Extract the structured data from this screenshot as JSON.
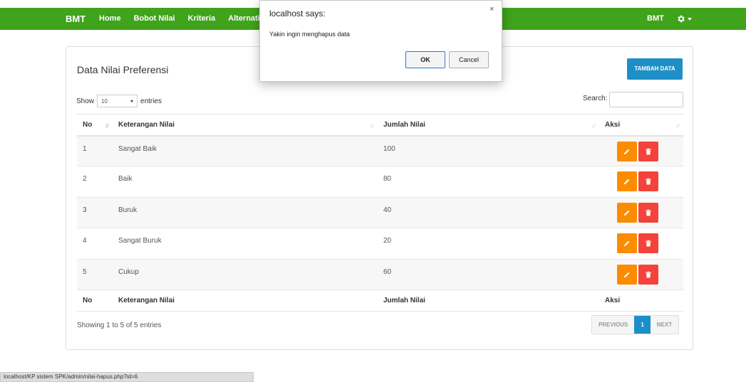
{
  "navbar": {
    "brand": "BMT",
    "items": [
      "Home",
      "Bobot Nilai",
      "Kriteria",
      "Alternati"
    ],
    "user": "BMT",
    "accent": "#3fa31c"
  },
  "panel": {
    "title": "Data Nilai Preferensi",
    "add_button": "TAMBAH DATA",
    "show_label": "Show",
    "entries_value": "10",
    "entries_label": "entries",
    "search_label": "Search:",
    "search_value": ""
  },
  "table": {
    "headers": [
      "No",
      "Keterangan Nilai",
      "Jumlah Nilai",
      "Aksi"
    ],
    "rows": [
      [
        "1",
        "Sangat Baik",
        "100"
      ],
      [
        "2",
        "Baik",
        "80"
      ],
      [
        "3",
        "Buruk",
        "40"
      ],
      [
        "4",
        "Sangat Buruk",
        "20"
      ],
      [
        "5",
        "Cukup",
        "60"
      ]
    ],
    "footer": [
      "No",
      "Keterangan Nilai",
      "Jumlah Nilai",
      "Aksi"
    ]
  },
  "info": "Showing 1 to 5 of 5 entries",
  "pagination": {
    "previous": "PREVIOUS",
    "current": "1",
    "next": "NEXT"
  },
  "statusbar": "localhost/KP sistem SPK/admin/nilai-hapus.php?id=6",
  "dialog": {
    "title": "localhost says:",
    "close": "×",
    "message": "Yakin ingin menghapus data",
    "ok": "OK",
    "cancel": "Cancel"
  },
  "icons": {
    "settings": "gear-icon",
    "edit": "pencil-icon",
    "delete": "trash-icon"
  },
  "colors": {
    "primary": "#1e8fc6",
    "edit": "#fb8c00",
    "delete": "#f4433a"
  }
}
